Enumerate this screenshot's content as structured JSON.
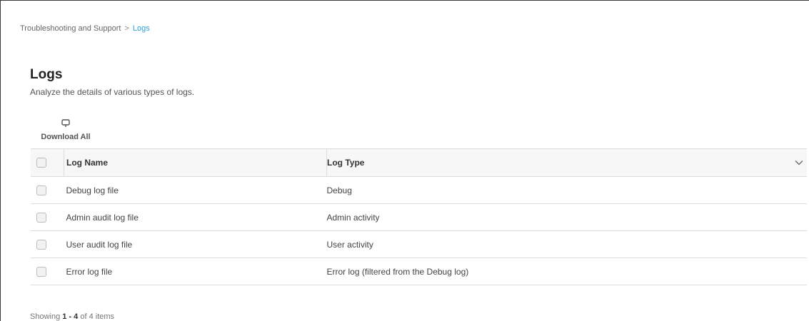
{
  "breadcrumb": {
    "parent": "Troubleshooting and Support",
    "separator": ">",
    "current": "Logs"
  },
  "page": {
    "title": "Logs",
    "subtitle": "Analyze the details of various types of logs."
  },
  "toolbar": {
    "download_all_label": "Download All",
    "download_icon": "download-icon"
  },
  "table": {
    "columns": [
      "Log Name",
      "Log Type"
    ],
    "rows": [
      {
        "name": "Debug log file",
        "type": "Debug"
      },
      {
        "name": "Admin audit log file",
        "type": "Admin activity"
      },
      {
        "name": "User audit log file",
        "type": "User activity"
      },
      {
        "name": "Error log file",
        "type": "Error log (filtered from the Debug log)"
      }
    ]
  },
  "footer": {
    "prefix": "Showing",
    "range": "1 - 4",
    "middle": "of",
    "total": "4",
    "suffix": "items"
  },
  "colors": {
    "accent": "#2a9fd6",
    "header_bg": "#f7f7f7",
    "border": "#dcdcdc"
  }
}
